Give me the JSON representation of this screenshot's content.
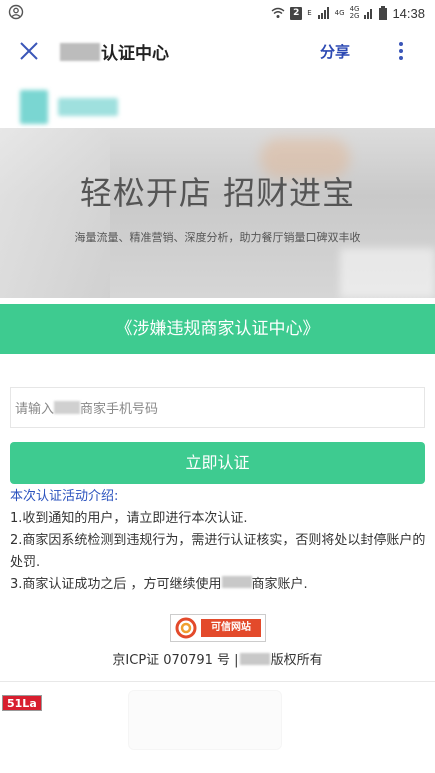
{
  "status_bar": {
    "time": "14:38",
    "sim_number": "2",
    "network_e": "E",
    "network_4g": "4G",
    "network_4g_small": "4G",
    "network_2g_small": "2G"
  },
  "nav": {
    "title_suffix": "认证中心",
    "share_label": "分享",
    "close_icon": "close-icon",
    "more_icon": "more-vertical-icon"
  },
  "hero": {
    "title": "轻松开店 招财进宝",
    "subtitle": "海量流量、精准营销、深度分析，助力餐厅销量口碑双丰收"
  },
  "banner": {
    "text": "《涉嫌违规商家认证中心》"
  },
  "form": {
    "placeholder_prefix": "请输入",
    "placeholder_suffix": "商家手机号码",
    "submit_label": "立即认证"
  },
  "info": {
    "heading": "本次认证活动介绍:",
    "item1": "1.收到通知的用户，请立即进行本次认证.",
    "item2": "2.商家因系统检测到违规行为，需进行认证核实，否则将处以封停账户的处罚.",
    "item3_prefix": "3.商家认证成功之后 ，方可继续使用",
    "item3_suffix": "商家账户."
  },
  "badge": {
    "text": "可信网站"
  },
  "footer": {
    "icp_prefix": "京ICP证 070791 号 |",
    "icp_suffix": "版权所有"
  },
  "stats_badge": "51La",
  "colors": {
    "accent_green": "#3ecb90",
    "share_blue": "#2c49b3",
    "heading_blue": "#2a52be",
    "badge_red": "#e34a2b"
  }
}
